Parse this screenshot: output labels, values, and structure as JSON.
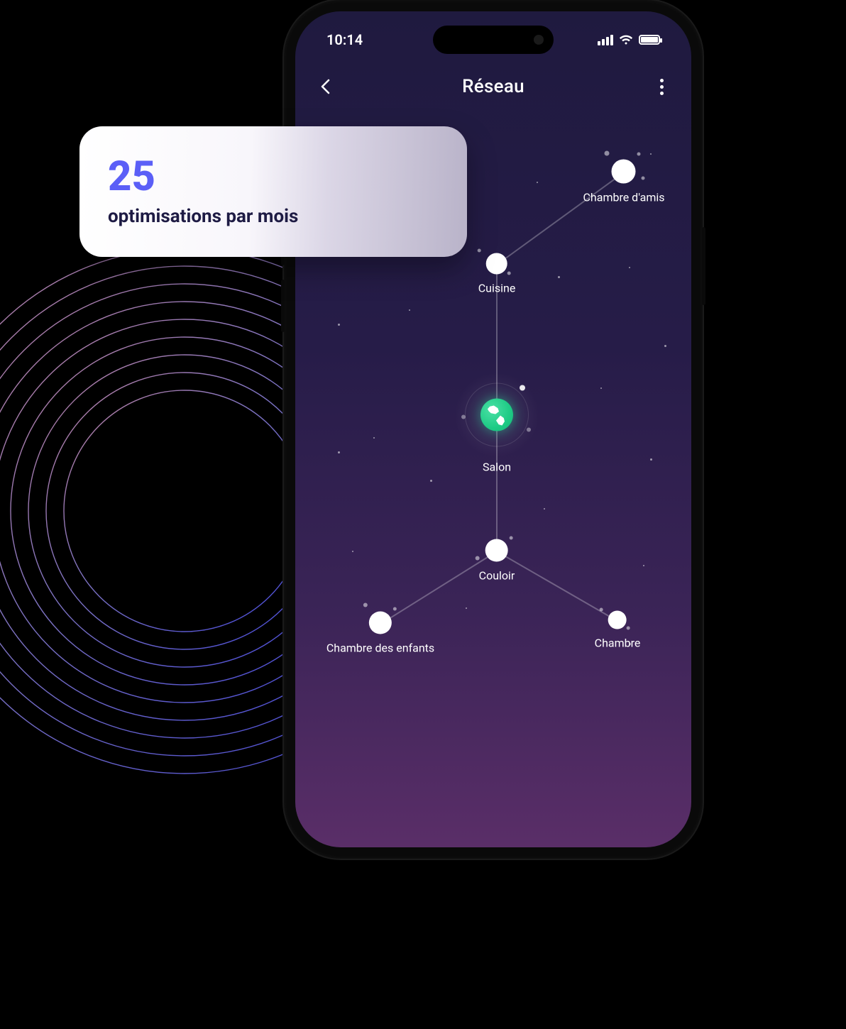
{
  "status": {
    "time": "10:14"
  },
  "nav": {
    "title": "Réseau"
  },
  "card": {
    "value": "25",
    "caption": "optimisations par mois"
  },
  "nodes": {
    "hub": {
      "label": "Salon"
    },
    "cuisine": {
      "label": "Cuisine"
    },
    "chambre_amis": {
      "label": "Chambre d'amis"
    },
    "couloir": {
      "label": "Couloir"
    },
    "chambre_enfants": {
      "label": "Chambre des enfants"
    },
    "chambre": {
      "label": "Chambre"
    }
  }
}
